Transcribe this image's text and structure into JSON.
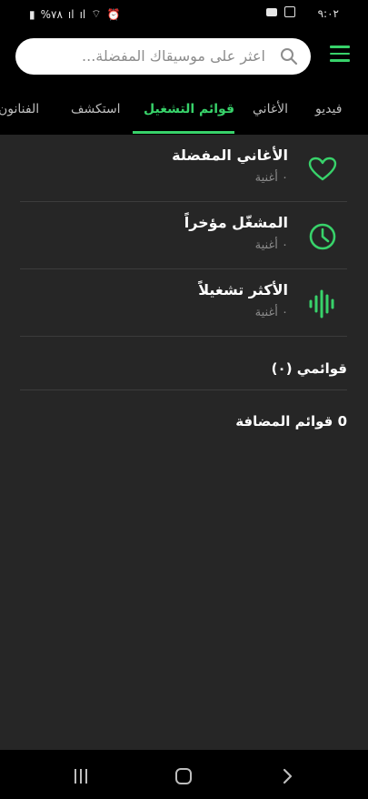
{
  "status_bar": {
    "time": "٩:٠٢",
    "battery": "%٧٨"
  },
  "search": {
    "placeholder": "اعثر على موسيقاك المفضلة..."
  },
  "tabs": [
    {
      "label": "فيديو"
    },
    {
      "label": "الأغاني"
    },
    {
      "label": "قوائم التشغيل"
    },
    {
      "label": "استكشف"
    },
    {
      "label": "الفنانون"
    }
  ],
  "active_tab": "قوائم التشغيل",
  "playlists": [
    {
      "title": "الأغاني المفضلة",
      "subtitle": "٠ أغنية",
      "icon": "heart-icon"
    },
    {
      "title": "المشغّل مؤخراً",
      "subtitle": "٠ أغنية",
      "icon": "clock-icon"
    },
    {
      "title": "الأكثر تشغيلاً",
      "subtitle": "٠ أغنية",
      "icon": "sound-wave-icon"
    }
  ],
  "my_playlists": "قوائمي (٠)",
  "added_playlists": "0 قوائم المضافة",
  "colors": {
    "accent": "#38d26a",
    "background": "#262626",
    "bar": "#000000"
  }
}
